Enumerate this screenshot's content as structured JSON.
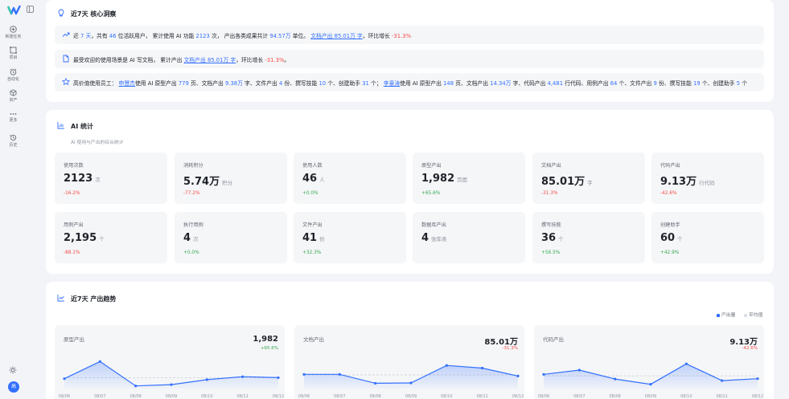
{
  "sidebar": {
    "items": [
      {
        "label": "新建任务",
        "icon": "plus-circle-icon"
      },
      {
        "label": "项目",
        "icon": "project-icon"
      },
      {
        "label": "自动化",
        "icon": "alarm-icon"
      },
      {
        "label": "资产",
        "icon": "cube-icon"
      },
      {
        "label": "更多",
        "icon": "more-icon"
      },
      {
        "label": "历史",
        "icon": "history-icon"
      }
    ],
    "avatar_text": "高"
  },
  "insights": {
    "title": "近7天 核心洞察",
    "row1": {
      "p1": "近 ",
      "days": "7 天",
      "p2": "，共有 ",
      "users": "46",
      "p3": " 位活跃用户， 累计使用 AI 功能 ",
      "uses": "2123",
      "p4": " 次， 产出各类成果共计 ",
      "outputs": "94.57万",
      "p5": " 单位。 ",
      "doc": "文档产出 85.01万 字",
      "p6": "，环比增长 ",
      "growth": "-31.3%"
    },
    "row2": {
      "p1": "最受欢迎的使用场景是 AI 写文档， 累计产出 ",
      "doc": "文档产出 85.01万 字",
      "p2": "，环比增长 ",
      "growth": "-31.3%",
      "p3": "。"
    },
    "row3": {
      "p1": "高价值使用员工： ",
      "user1": "申慧杰",
      "u1a": "使用 AI 原型产出 ",
      "u1b": "779",
      "u1c": " 页、文档产出 ",
      "u1d": "9.38万",
      "u1e": " 字、文件产出 ",
      "u1f": "4",
      "u1g": " 份、撰写技能 ",
      "u1h": "10",
      "u1i": " 个、创建助手 ",
      "u1j": "31",
      "u1k": " 个； ",
      "user2": "李豪涛",
      "u2a": "使用 AI 原型产出 ",
      "u2b": "148",
      "u2c": " 页、文档产出 ",
      "u2d": "14.34万",
      "u2e": " 字、代码产出 ",
      "u2f": "4,481",
      "u2g": " 行代码、用例产出 ",
      "u2h": "64",
      "u2i": " 个、文件产出 ",
      "u2j": "9",
      "u2k": " 份、撰写技能 ",
      "u2l": "19",
      "u2m": " 个、创建助手 ",
      "u2n": "5",
      "u2o": " 个"
    }
  },
  "stats": {
    "title": "AI 统计",
    "subtitle": "AI 使用与产出的综合统计",
    "cards": [
      {
        "label": "使用次数",
        "value": "2123",
        "unit": "次",
        "change": "-16.2%",
        "trend": "neg"
      },
      {
        "label": "消耗积分",
        "value": "5.74万",
        "unit": "积分",
        "change": "-77.2%",
        "trend": "neg"
      },
      {
        "label": "使用人数",
        "value": "46",
        "unit": "人",
        "change": "+0.0%",
        "trend": "pos"
      },
      {
        "label": "原型产出",
        "value": "1,982",
        "unit": "页面",
        "change": "+65.6%",
        "trend": "pos"
      },
      {
        "label": "文档产出",
        "value": "85.01万",
        "unit": "字",
        "change": "-31.3%",
        "trend": "neg"
      },
      {
        "label": "代码产出",
        "value": "9.13万",
        "unit": "行代码",
        "change": "-42.6%",
        "trend": "neg"
      },
      {
        "label": "用例产出",
        "value": "2,195",
        "unit": "个",
        "change": "-88.1%",
        "trend": "neg"
      },
      {
        "label": "执行用例",
        "value": "4",
        "unit": "次",
        "change": "+0.0%",
        "trend": "pos"
      },
      {
        "label": "文件产出",
        "value": "41",
        "unit": "份",
        "change": "+32.3%",
        "trend": "pos"
      },
      {
        "label": "数据库产出",
        "value": "4",
        "unit": "张库表",
        "change": "",
        "trend": "pos"
      },
      {
        "label": "撰写技能",
        "value": "36",
        "unit": "个",
        "change": "+56.5%",
        "trend": "pos"
      },
      {
        "label": "创建助手",
        "value": "60",
        "unit": "个",
        "change": "+42.9%",
        "trend": "pos"
      }
    ]
  },
  "trend": {
    "title": "近7天 产出趋势",
    "legend": [
      {
        "label": "产出量",
        "color": "#3370ff"
      },
      {
        "label": "平均值",
        "color": "#dcdfe6"
      }
    ],
    "colors": {
      "line": "#3370ff",
      "avg": "#c9cdd4"
    }
  },
  "chart_data": [
    {
      "type": "area",
      "title": "原型产出",
      "total": "1,982",
      "change": "+65.6%",
      "x": [
        "08/06",
        "08/07",
        "08/08",
        "08/09",
        "08/10",
        "08/11",
        "08/12"
      ],
      "values": [
        300,
        820,
        80,
        120,
        270,
        360,
        330
      ]
    },
    {
      "type": "area",
      "title": "文档产出",
      "total": "85.01万",
      "change": "-31.3%",
      "x": [
        "08/06",
        "08/07",
        "08/08",
        "08/09",
        "08/10",
        "08/11",
        "08/12"
      ],
      "values": [
        430,
        430,
        160,
        170,
        700,
        620,
        380
      ]
    },
    {
      "type": "area",
      "title": "代码产出",
      "total": "9.13万",
      "change": "-42.6%",
      "x": [
        "08/06",
        "08/07",
        "08/08",
        "08/09",
        "08/10",
        "08/11",
        "08/12"
      ],
      "values": [
        430,
        560,
        290,
        130,
        750,
        240,
        300
      ]
    }
  ]
}
